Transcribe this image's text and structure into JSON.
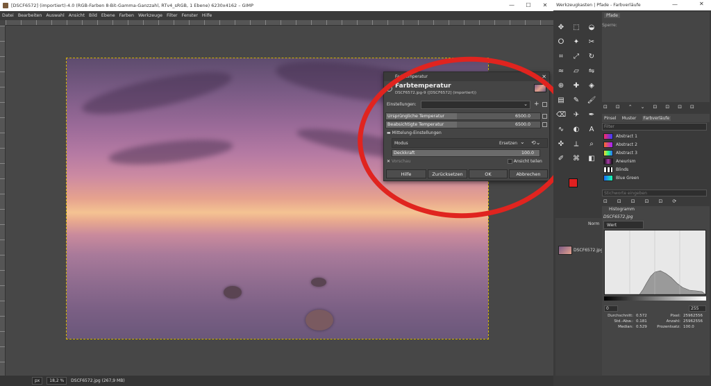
{
  "main_window": {
    "title": "[DSCF6572] (importiert)-4.0 (RGB-Farben 8-Bit-Gamma-Ganzzahl, RTv4_sRGB, 1 Ebene) 6230x4162 – GIMP",
    "menu": [
      "Datei",
      "Bearbeiten",
      "Auswahl",
      "Ansicht",
      "Bild",
      "Ebene",
      "Farben",
      "Werkzeuge",
      "Filter",
      "Fenster",
      "Hilfe"
    ],
    "controls": {
      "minimize": "—",
      "maximize": "☐",
      "close": "✕"
    }
  },
  "statusbar": {
    "unit": "px",
    "zoom": "18,2 %",
    "file": "DSCF6572.jpg (267,9 MB)"
  },
  "dialog": {
    "window_title": "Farbtemperatur",
    "heading": "Farbtemperatur",
    "subheading": "DSCF6572.jpg-9 ([DSCF6572] (importiert))",
    "close": "✕",
    "presets_label": "Einstellungen:",
    "presets_value": "",
    "original_temp_label": "Ursprüngliche Temperatur",
    "original_temp_value": "6500.0",
    "intended_temp_label": "Beabsichtigte Temperatur",
    "intended_temp_value": "6500.0",
    "blend_section": "Mittelung-Einstellungen",
    "mode_label": "Modus",
    "mode_value": "Ersetzen",
    "opacity_label": "Deckkraft",
    "opacity_value": "100.0",
    "preview_label": "Vorschau",
    "split_view_label": "Ansicht teilen",
    "buttons": {
      "help": "Hilfe",
      "reset": "Zurücksetzen",
      "ok": "OK",
      "cancel": "Abbrechen"
    }
  },
  "toolbox": {
    "title": "Werkzeugkasten | Pfade - Farbverläufe",
    "tool_icons": [
      "move-icon",
      "rect-select-icon",
      "fg-select-icon",
      "lasso-icon",
      "fuzzy-select-icon",
      "scissors-icon",
      "crop-icon",
      "unified-transform-icon",
      "rotate-icon",
      "warp-icon",
      "perspective-icon",
      "flip-icon",
      "clone-icon",
      "heal-icon",
      "paint-bucket-icon",
      "gradient-icon",
      "pencil-icon",
      "paintbrush-icon",
      "eraser-icon",
      "airbrush-icon",
      "ink-icon",
      "smudge-icon",
      "dodge-icon",
      "text-icon",
      "color-picker-icon",
      "measure-icon",
      "zoom-icon",
      "paths-icon",
      "cage-icon",
      "blend-icon"
    ],
    "fg_color": "#e02020",
    "bg_color": "#1aa83a"
  },
  "paths_panel": {
    "tab": "Pfade",
    "lock_label": "Sperre:"
  },
  "brushes_panel": {
    "tabs": [
      "Pinsel",
      "Muster",
      "Farbverläufe"
    ],
    "filter_label": "Filter",
    "items": [
      {
        "name": "Abstract 1",
        "swatch": "linear-gradient(90deg,#ff2a6a,#3a3aff)"
      },
      {
        "name": "Abstract 2",
        "swatch": "linear-gradient(90deg,#ff6a2a,#a21eff)"
      },
      {
        "name": "Abstract 3",
        "swatch": "linear-gradient(90deg,#ffd42a,#2aff8a,#2a6aff)"
      },
      {
        "name": "Aneurism",
        "swatch": "linear-gradient(90deg,#111,#aa3aaa,#111)"
      },
      {
        "name": "Blinds",
        "swatch": "repeating-linear-gradient(90deg,#fff 0 3px,#000 3px 5px)"
      },
      {
        "name": "Blue Green",
        "swatch": "linear-gradient(90deg,#1a6aff,#1affaa)"
      }
    ],
    "search_placeholder": "Stichworte eingeben"
  },
  "layers_panel": {
    "mode": "Norm",
    "layer_name": "DSCF6572.jpg"
  },
  "histogram": {
    "title": "Histogramm",
    "file": "DSCF6572.jpg",
    "channel": "Wert",
    "range_min": "0",
    "range_max": "255",
    "stats": {
      "mean_label": "Durchschnitt:",
      "mean": "0.572",
      "std_label": "Std.-Abw.:",
      "std": "0.181",
      "median_label": "Median:",
      "median": "0.529",
      "pixels_label": "Pixel:",
      "pixels": "25962556",
      "count_label": "Anzahl:",
      "count": "25962556",
      "percent_label": "Prozentsatz:",
      "percent": "100.0"
    }
  },
  "colors": {
    "marker": "#e0241f",
    "selection": "#d7b600"
  }
}
